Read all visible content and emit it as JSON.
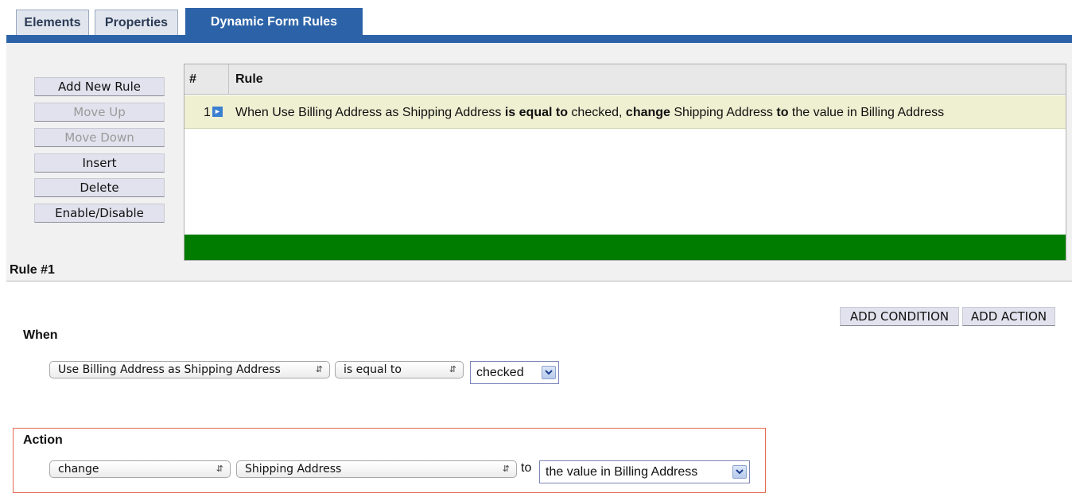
{
  "tabs": [
    {
      "label": "Elements"
    },
    {
      "label": "Properties"
    },
    {
      "label": "Dynamic Form Rules"
    }
  ],
  "toolbar": {
    "add_new_rule": "Add New Rule",
    "move_up": "Move Up",
    "move_down": "Move Down",
    "insert": "Insert",
    "delete": "Delete",
    "enable_disable": "Enable/Disable"
  },
  "table": {
    "col_num": "#",
    "col_rule": "Rule",
    "rows": [
      {
        "num": "1",
        "parts": {
          "p1": "When Use Billing Address as Shipping Address ",
          "b1": "is equal to",
          "p2": " checked, ",
          "b2": "change",
          "p3": " Shipping Address ",
          "b3": "to",
          "p4": " the value in Billing Address"
        }
      }
    ],
    "status_bar_color": "#007c00"
  },
  "editor": {
    "title": "Rule #1",
    "add_condition": "ADD CONDITION",
    "add_action": "ADD ACTION",
    "when_label": "When",
    "condition": {
      "field": "Use Billing Address as Shipping Address",
      "operator": "is equal to",
      "value": "checked"
    },
    "action_label": "Action",
    "action": {
      "verb": "change",
      "target": "Shipping Address",
      "to_label": "to",
      "value": "the value in Billing Address"
    }
  },
  "colors": {
    "accent": "#2c63a8",
    "row_highlight": "#efefd2",
    "action_border": "#e36a50"
  }
}
